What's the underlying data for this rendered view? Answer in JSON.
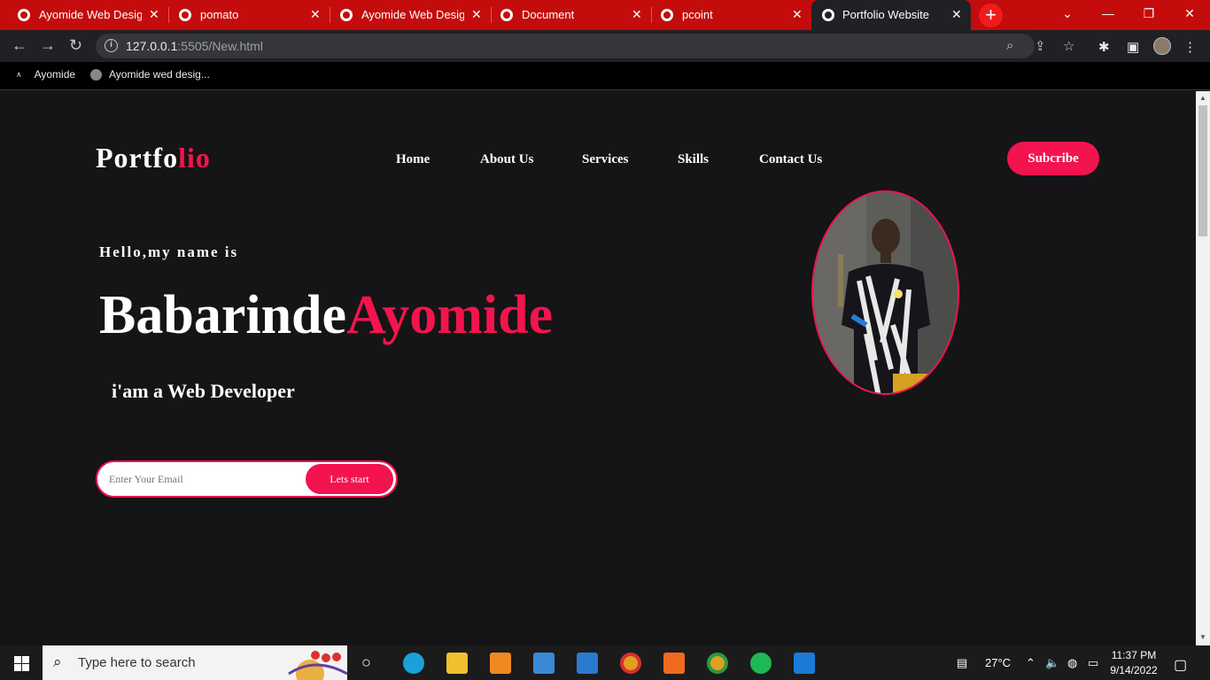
{
  "browser": {
    "tabs": [
      {
        "title": "Ayomide Web Design",
        "active": false
      },
      {
        "title": "pomato",
        "active": false
      },
      {
        "title": "Ayomide Web Design",
        "active": false
      },
      {
        "title": "Document",
        "active": false
      },
      {
        "title": "pcoint",
        "active": false
      },
      {
        "title": "Portfolio Website",
        "active": true
      }
    ],
    "new_tab": "+",
    "url_host": "127.0.0.1",
    "url_rest": ":5505/New.html",
    "bookmarks": [
      {
        "label": "Ayomide"
      },
      {
        "label": "Ayomide wed desig..."
      }
    ]
  },
  "page": {
    "logo_main": "Portfo",
    "logo_accent": "lio",
    "nav": [
      "Home",
      "About Us",
      "Services",
      "Skills",
      "Contact Us"
    ],
    "subscribe_label": "Subcribe",
    "greeting": "Hello,my name is",
    "first_name": "Babarinde",
    "last_name": "Ayomide",
    "role": "i'am a Web Developer",
    "email_placeholder": "Enter Your Email",
    "cta_label": "Lets start",
    "accent_color": "#f2134f"
  },
  "taskbar": {
    "search_placeholder": "Type here to search",
    "weather": "27°C",
    "time": "11:37 PM",
    "date": "9/14/2022"
  }
}
